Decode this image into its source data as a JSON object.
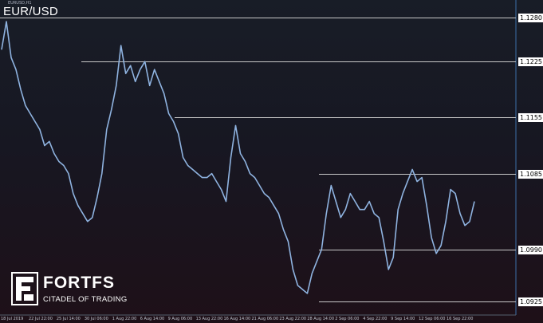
{
  "window": {
    "symbol": "EUR/USD",
    "small_label": "EURUSD,H1"
  },
  "colors": {
    "background_top": "#181d27",
    "background_bottom": "#1e1018",
    "price_line": "#8fb3e0",
    "level_line": "#c8c8c8",
    "separator_line": "#3d6fa8",
    "label_bg": "#ffffff"
  },
  "logo": {
    "name": "FORTFS",
    "tagline": "CITADEL OF TRADING",
    "icon": "fortfs-logo-icon"
  },
  "chart_data": {
    "type": "line",
    "series": [
      {
        "values": [
          1.124,
          1.1275,
          1.123,
          1.1215,
          1.119,
          1.117,
          1.116,
          1.115,
          1.114,
          1.112,
          1.1125,
          1.111,
          1.11,
          1.1095,
          1.1085,
          1.106,
          1.1045,
          1.1035,
          1.1025,
          1.103,
          1.1055,
          1.1085,
          1.114,
          1.1165,
          1.1195,
          1.1245,
          1.121,
          1.122,
          1.12,
          1.1215,
          1.1225,
          1.1195,
          1.1215,
          1.12,
          1.1185,
          1.116,
          1.115,
          1.1135,
          1.1105,
          1.1095,
          1.109,
          1.1085,
          1.108,
          1.108,
          1.1085,
          1.1075,
          1.1065,
          1.105,
          1.1105,
          1.1145,
          1.111,
          1.11,
          1.1085,
          1.108,
          1.107,
          1.106,
          1.1055,
          1.1045,
          1.1035,
          1.1015,
          1.1,
          1.0965,
          1.0945,
          1.094,
          1.0935,
          1.096,
          1.0975,
          1.099,
          1.1035,
          1.107,
          1.105,
          1.103,
          1.104,
          1.106,
          1.105,
          1.104,
          1.104,
          1.105,
          1.1035,
          1.103,
          1.1,
          1.0965,
          1.098,
          1.104,
          1.106,
          1.1075,
          1.109,
          1.1075,
          1.108,
          1.1045,
          1.1005,
          1.0985,
          1.0995,
          1.1025,
          1.1065,
          1.106,
          1.1035,
          1.102,
          1.1025,
          1.105
        ]
      }
    ],
    "levels": [
      1.128,
      1.1225,
      1.1155,
      1.1085,
      1.099,
      1.0925
    ],
    "y_tick_labels": [
      "1.1280",
      "1.1225",
      "1.1155",
      "1.1085",
      "1.0990",
      "1.0925"
    ],
    "x_tick_labels": [
      "18 Jul 2019",
      "22 Jul 22:00",
      "25 Jul 14:00",
      "30 Jul 06:00",
      "1 Aug 22:00",
      "6 Aug 14:00",
      "9 Aug 06:00",
      "13 Aug 22:00",
      "16 Aug 14:00",
      "21 Aug 06:00",
      "23 Aug 22:00",
      "28 Aug 14:00",
      "2 Sep 06:00",
      "4 Sep 22:00",
      "9 Sep 14:00",
      "12 Sep 06:00",
      "16 Sep 22:00"
    ],
    "grid": false,
    "ylim": [
      1.0908,
      1.1302
    ]
  }
}
